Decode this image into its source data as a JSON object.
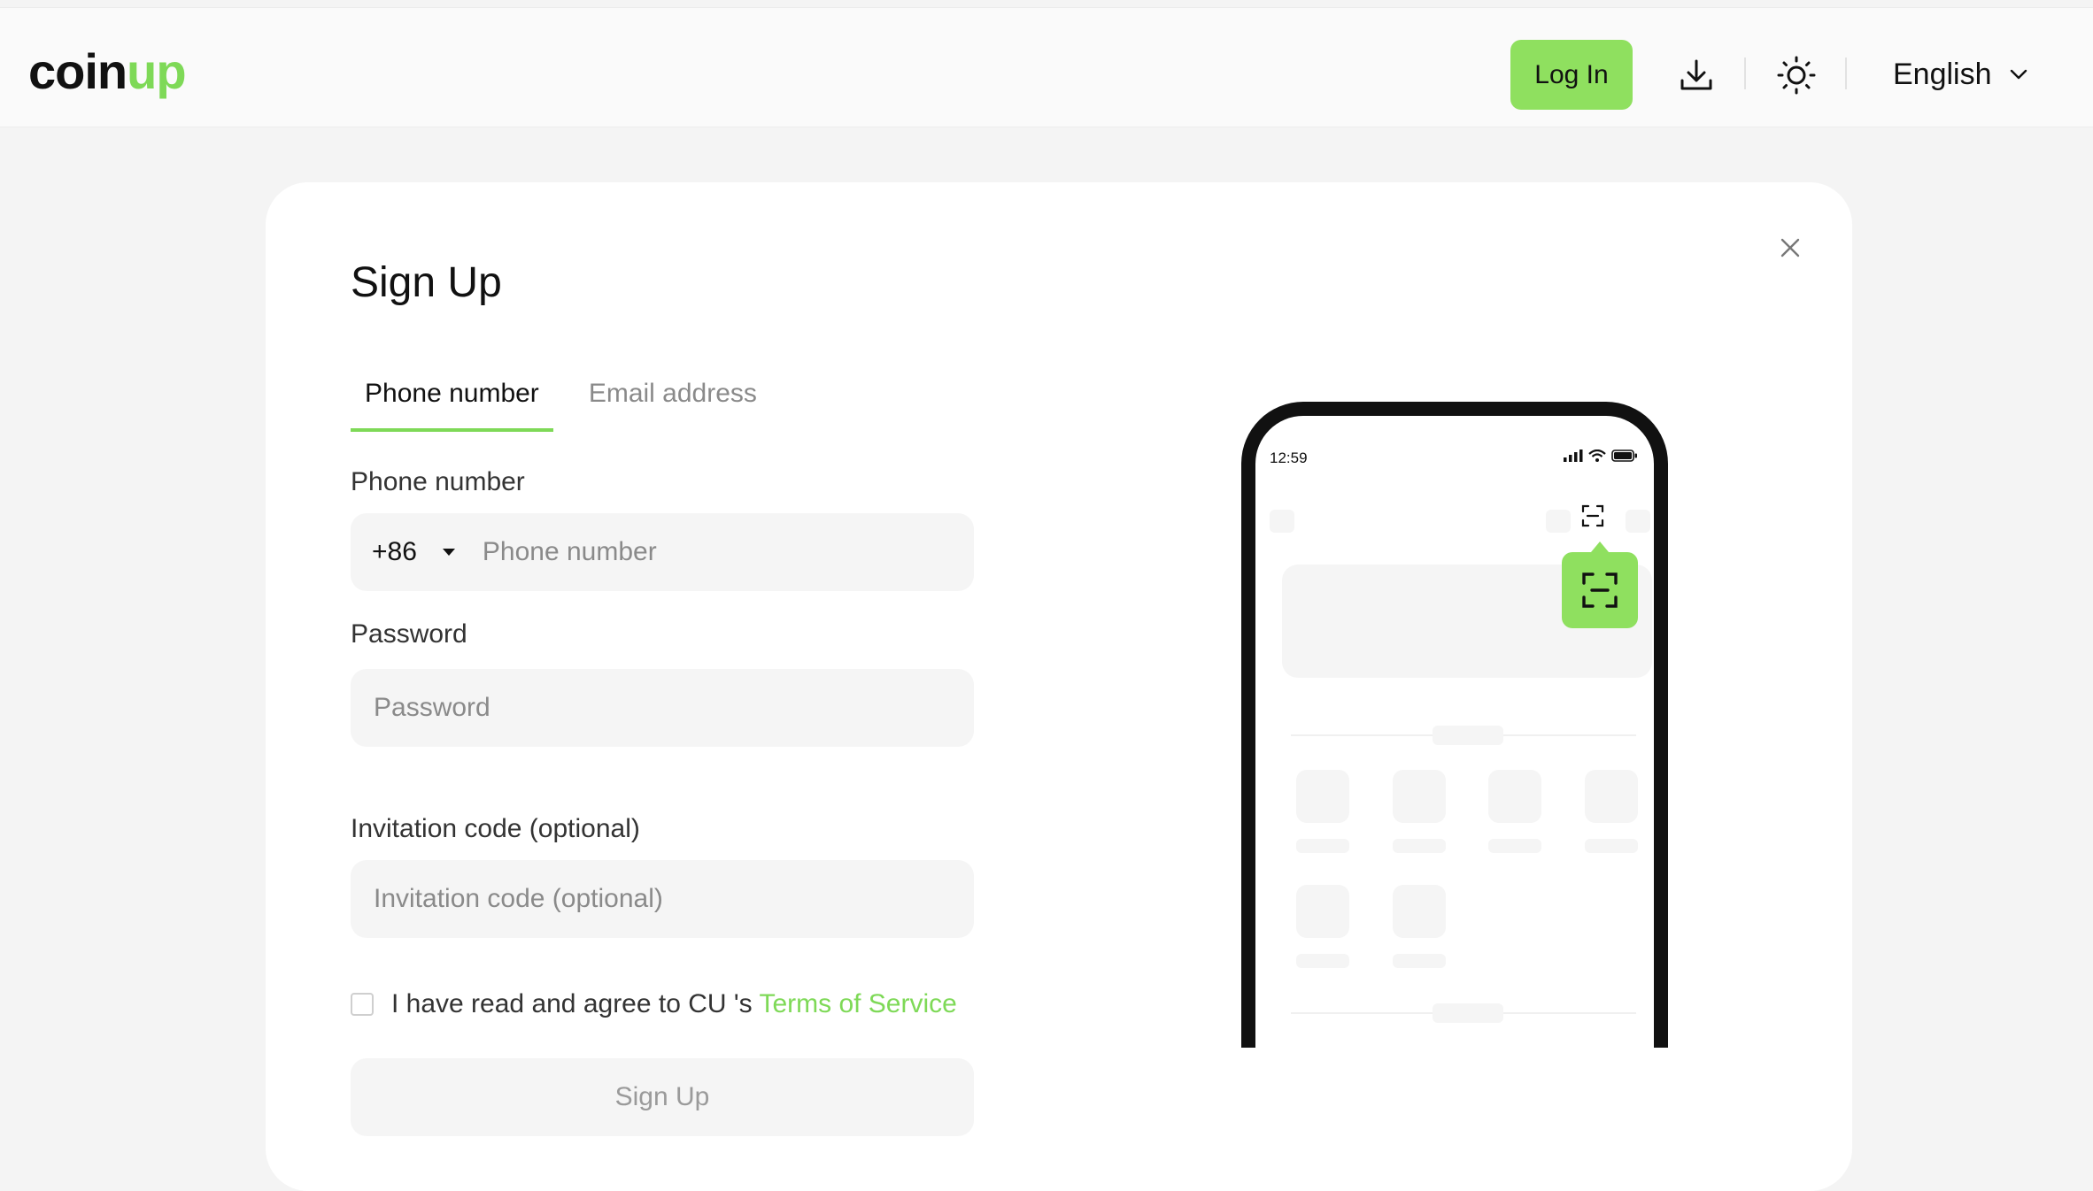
{
  "header": {
    "logo": {
      "part1": "coin",
      "part2": "up"
    },
    "login_label": "Log In",
    "language": "English",
    "icons": [
      "download-icon",
      "sun-icon",
      "chevron-down-icon"
    ]
  },
  "form": {
    "title": "Sign Up",
    "tabs": [
      {
        "label": "Phone number",
        "active": true
      },
      {
        "label": "Email address",
        "active": false
      }
    ],
    "phone_label": "Phone number",
    "country_code": "+86",
    "phone_placeholder": "Phone number",
    "password_label": "Password",
    "password_placeholder": "Password",
    "invite_label": "Invitation code (optional)",
    "invite_placeholder": "Invitation code (optional)",
    "agree_text": "I have read and agree to CU 's",
    "tos_link": "Terms of Service",
    "submit_label": "Sign Up"
  },
  "phone": {
    "time": "12:59"
  },
  "colors": {
    "accent": "#8fe05f",
    "link": "#7ed957",
    "field_bg": "#f5f5f5",
    "page_bg": "#f4f4f4"
  }
}
